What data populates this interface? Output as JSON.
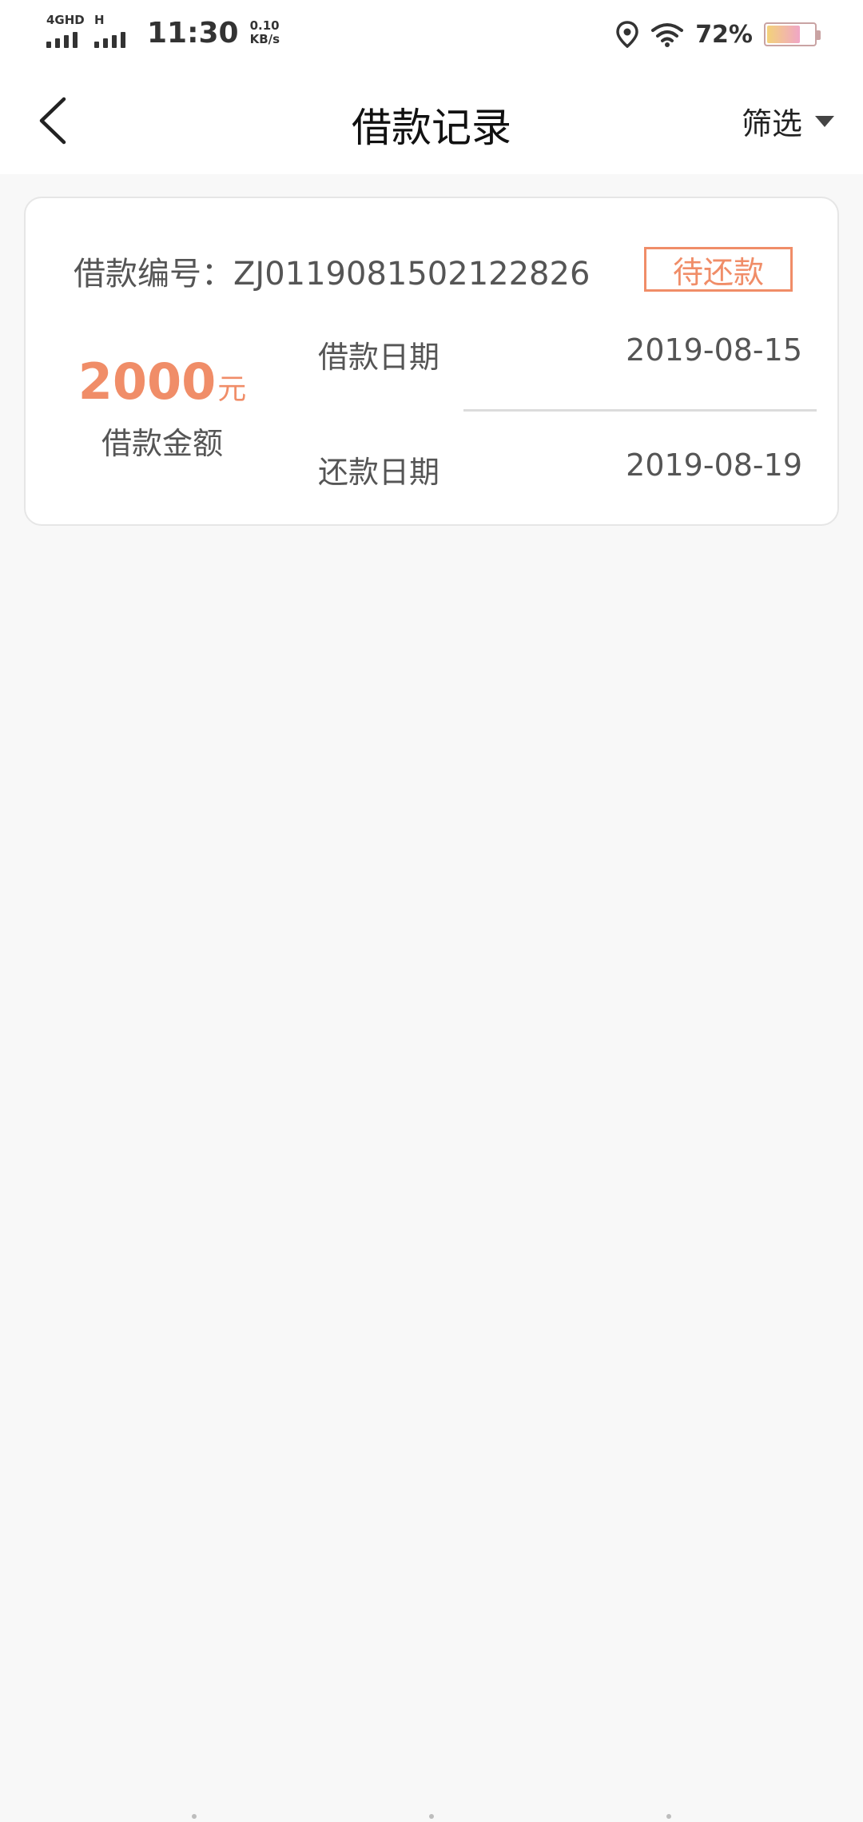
{
  "status_bar": {
    "network_1": "4GHD",
    "network_2": "H",
    "time": "11:30",
    "speed_value": "0.10",
    "speed_unit": "KB/s",
    "battery_percent": "72%",
    "battery_level": 0.72
  },
  "header": {
    "title": "借款记录",
    "filter_label": "筛选"
  },
  "loan": {
    "number_label": "借款编号：",
    "number": "ZJ0119081502122826",
    "status": "待还款",
    "amount": "2000",
    "amount_unit": "元",
    "amount_label": "借款金额",
    "loan_date_label": "借款日期",
    "loan_date": "2019-08-15",
    "repay_date_label": "还款日期",
    "repay_date": "2019-08-19"
  },
  "colors": {
    "accent": "#f08d68",
    "background": "#f8f8f8",
    "card": "#ffffff"
  }
}
